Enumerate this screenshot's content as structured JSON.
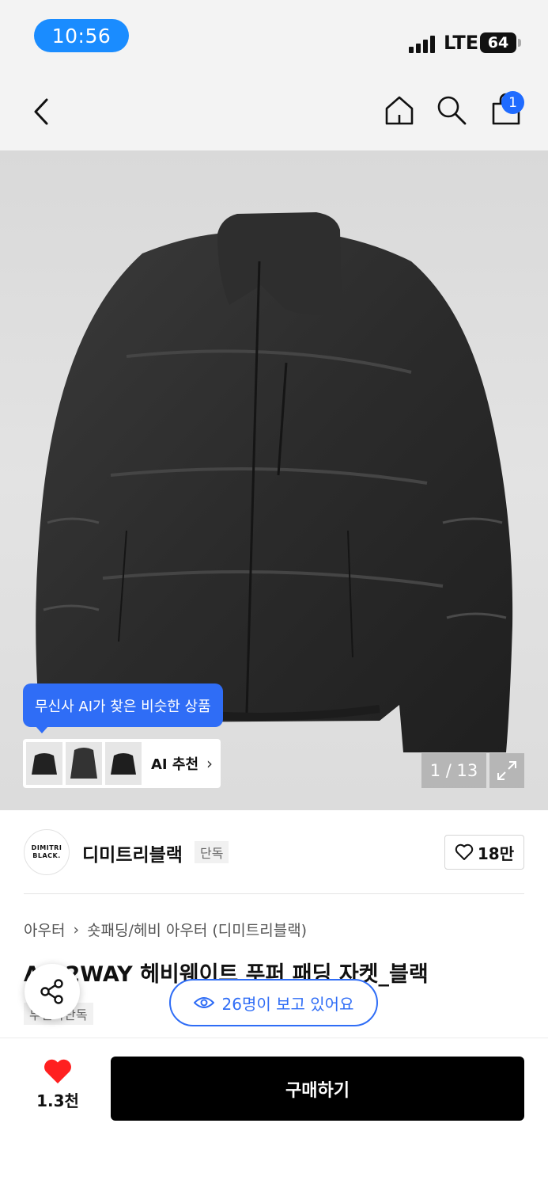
{
  "status_bar": {
    "time": "10:56",
    "network": "LTE",
    "battery": "64"
  },
  "header": {
    "back_icon": "chevron-left-icon",
    "home_icon": "home-icon",
    "search_icon": "search-icon",
    "cart_icon": "shopping-bag-icon",
    "cart_badge": "1"
  },
  "product_image": {
    "ai_tooltip": "무신사 AI가 찾은 비슷한 상품",
    "ai_card_label": "AI 추천",
    "image_counter": "1 / 13",
    "expand_icon": "expand-icon"
  },
  "brand": {
    "logo_line1": "DIMITRI",
    "logo_line2": "BLACK.",
    "name": "디미트리블랙",
    "badge": "단독",
    "like_count": "18만"
  },
  "breadcrumb": {
    "level1": "아우터",
    "level2": "숏패딩/헤비 아우터 (디미트리블랙)"
  },
  "product": {
    "title": "AG 2WAY 헤비웨이트 푸퍼 패딩 자켓_블랙",
    "exclusive_badge": "무신사단독",
    "viewers": "26명이 보고 있어요"
  },
  "bottom_bar": {
    "wish_count": "1.3천",
    "buy_label": "구매하기"
  },
  "colors": {
    "accent_blue": "#2f6df6",
    "heart_red": "#ff2020",
    "buy_black": "#000000"
  }
}
